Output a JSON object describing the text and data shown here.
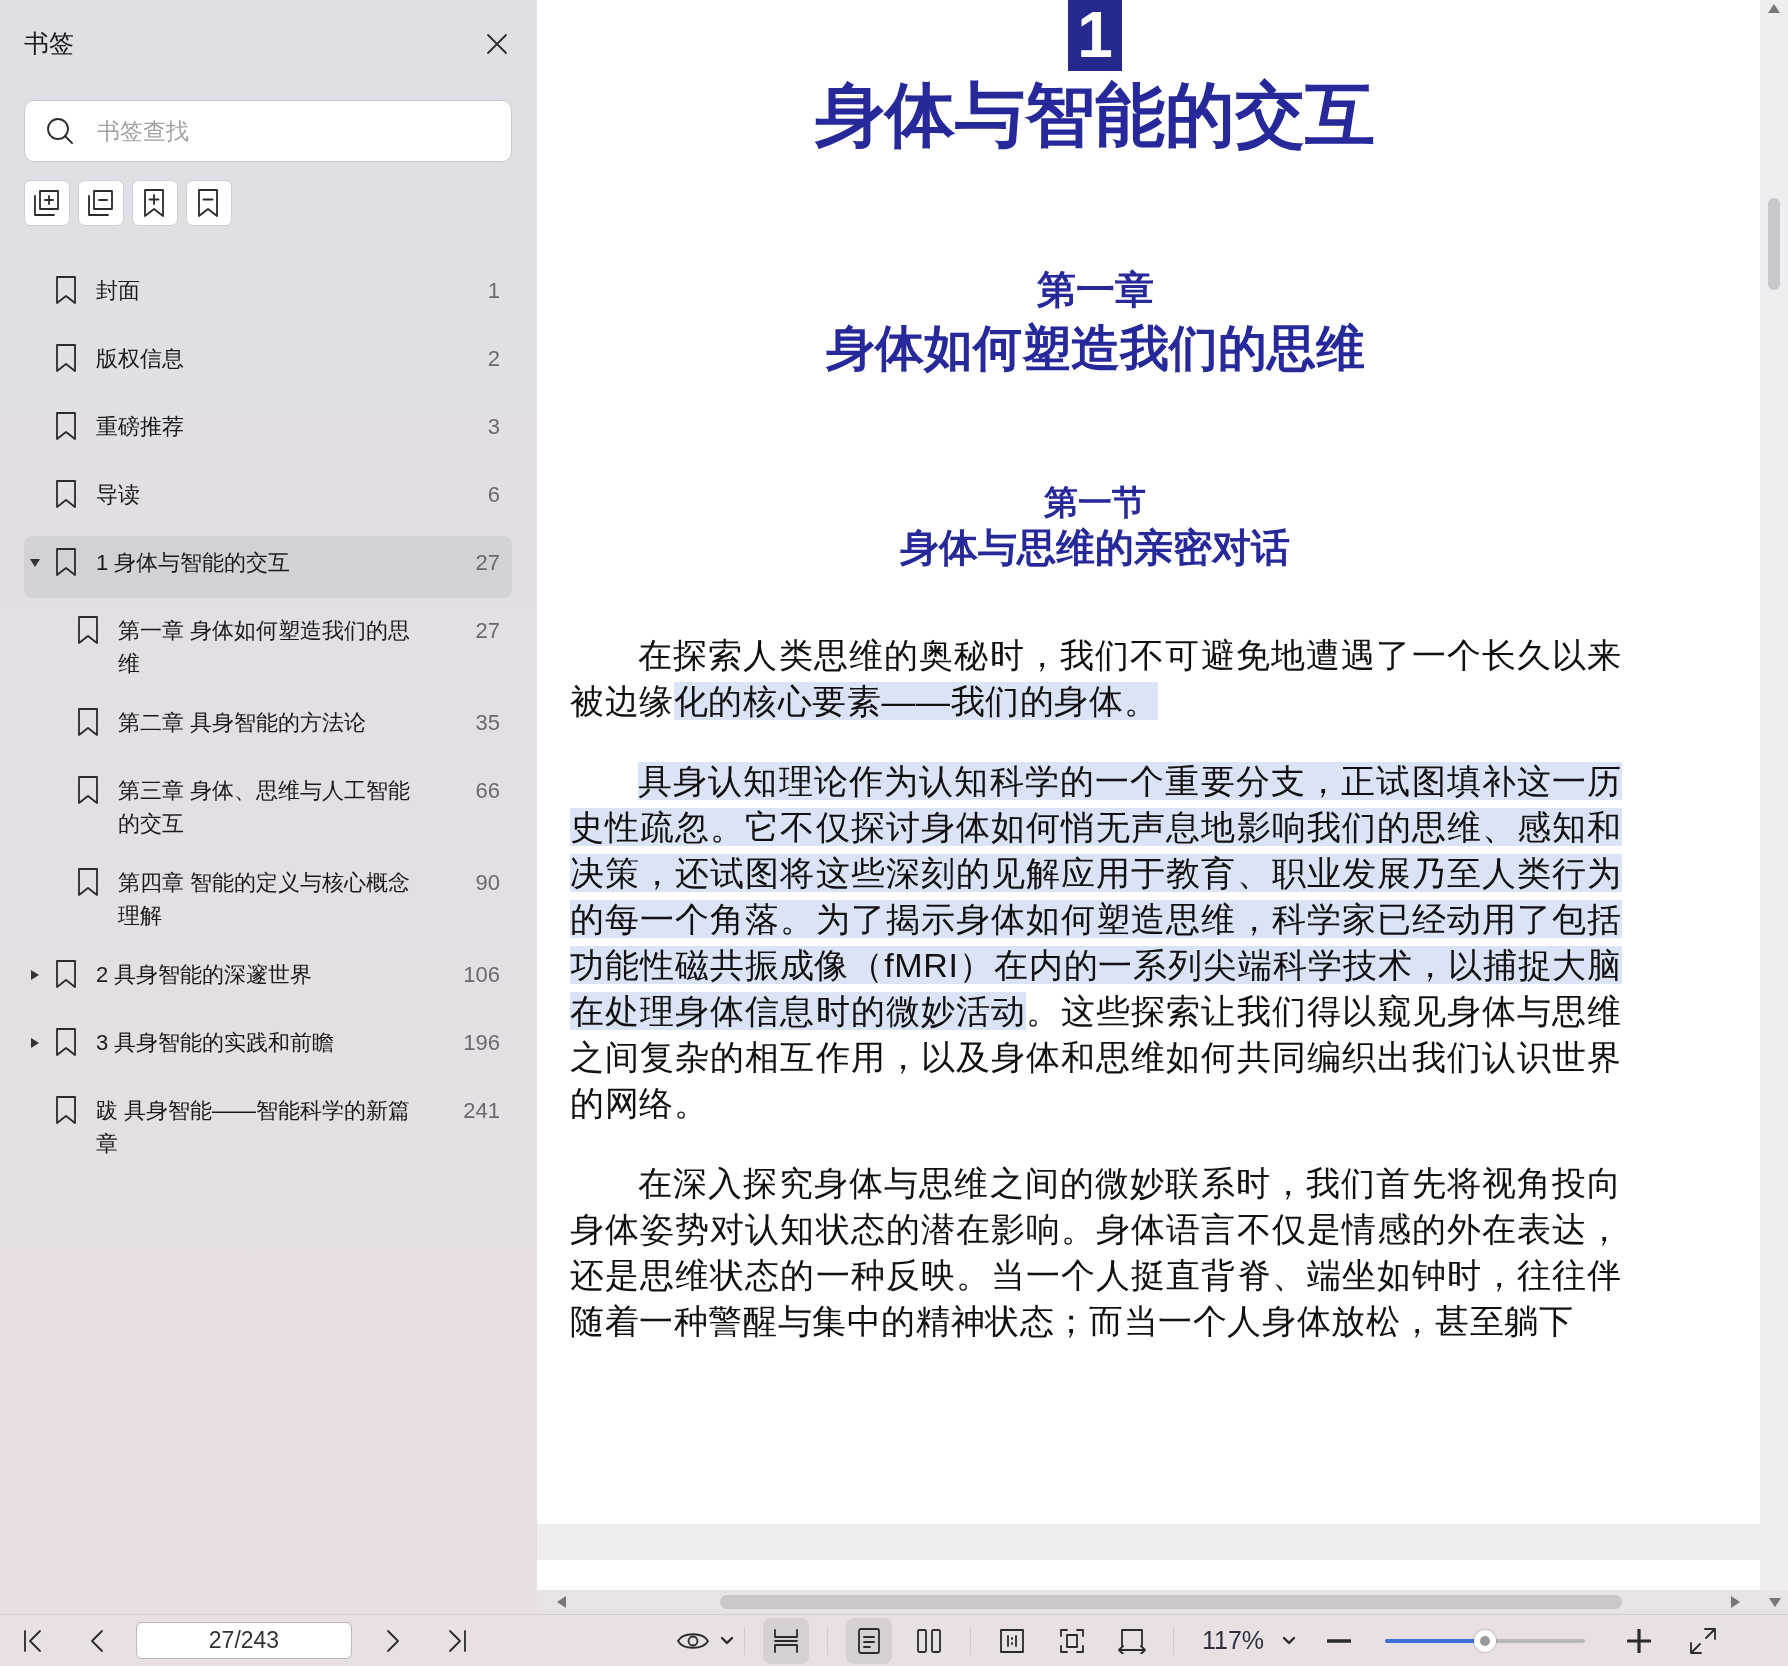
{
  "sidebar": {
    "title": "书签",
    "search": {
      "placeholder": "书签查找"
    },
    "tools": [
      {
        "kind": "expand-all"
      },
      {
        "kind": "collapse-all"
      },
      {
        "kind": "add"
      },
      {
        "kind": "remove"
      }
    ],
    "bookmarks": [
      {
        "label": "封面",
        "page": "1",
        "expandable": false,
        "expanded": false,
        "selected": false
      },
      {
        "label": "版权信息",
        "page": "2",
        "expandable": false,
        "expanded": false,
        "selected": false
      },
      {
        "label": "重磅推荐",
        "page": "3",
        "expandable": false,
        "expanded": false,
        "selected": false
      },
      {
        "label": "导读",
        "page": "6",
        "expandable": false,
        "expanded": false,
        "selected": false
      },
      {
        "label": "1 身体与智能的交互",
        "page": "27",
        "expandable": true,
        "expanded": true,
        "selected": true,
        "children": [
          {
            "label": "第一章 身体如何塑造我们的思维",
            "page": "27",
            "expandable": false,
            "expanded": false,
            "selected": false
          },
          {
            "label": "第二章 具身智能的方法论",
            "page": "35",
            "expandable": false,
            "expanded": false,
            "selected": false
          },
          {
            "label": "第三章 身体、思维与人工智能的交互",
            "page": "66",
            "expandable": false,
            "expanded": false,
            "selected": false
          },
          {
            "label": "第四章 智能的定义与核心概念理解",
            "page": "90",
            "expandable": false,
            "expanded": false,
            "selected": false
          }
        ]
      },
      {
        "label": "2 具身智能的深邃世界",
        "page": "106",
        "expandable": true,
        "expanded": false,
        "selected": false
      },
      {
        "label": "3 具身智能的实践和前瞻",
        "page": "196",
        "expandable": true,
        "expanded": false,
        "selected": false
      },
      {
        "label": "跋 具身智能——智能科学的新篇章",
        "page": "241",
        "expandable": false,
        "expanded": false,
        "selected": false
      }
    ]
  },
  "document": {
    "chapter_number": "1",
    "title": "身体与智能的交互",
    "chapter": "第一章",
    "chapter_title": "身体如何塑造我们的思维",
    "section": "第一节",
    "section_title": "身体与思维的亲密对话",
    "paragraphs": [
      {
        "segments": [
          {
            "text": "在探索人类思维的奥秘时，我们不可避免地遭遇了一个长久以来被边缘",
            "highlighted": false
          },
          {
            "text": "化的核心要素——我们的身体。",
            "highlighted": true
          }
        ]
      },
      {
        "segments": [
          {
            "text": "具身认知理论作为认知科学的一个重要分支，正试图填补这一历史性疏忽。它不仅探讨身体如何悄无声息地影响我们的思维、感知和决策，还试图将这些深刻的见解应用于教育、职业发展乃至人类行为的每一个角落。为了揭示身体如何塑造思维，科学家已经动用了包括功能性磁共振成像（fMRI）在内的一系列尖端科学技术，以捕捉大脑在处理身体信息时的微妙活动",
            "highlighted": true
          },
          {
            "text": "。这些探索让我们得以窥见身体与思维之间复杂的相互作用，以及身体和思维如何共同编织出我们认识世界的网络。",
            "highlighted": false
          }
        ]
      },
      {
        "segments": [
          {
            "text": "在深入探究身体与思维之间的微妙联系时，我们首先将视角投向身体姿势对认知状态的潜在影响。身体语言不仅是情感的外在表达，还是思维状态的一种反映。当一个人挺直背脊、端坐如钟时，往往伴随着一种警醒与集中的精神状态；而当一个人身体放松，甚至躺下",
            "highlighted": false
          }
        ]
      }
    ]
  },
  "toolbar": {
    "page_field": "27/243",
    "view_buttons": [
      {
        "kind": "continuous",
        "selected": true
      },
      {
        "kind": "single",
        "selected": true
      },
      {
        "kind": "two-page",
        "selected": false
      },
      {
        "kind": "actual-size",
        "selected": false
      },
      {
        "kind": "fit-page",
        "selected": false
      },
      {
        "kind": "fit-width",
        "selected": false
      }
    ],
    "zoom": "117%",
    "zoom_slider": {
      "level": 0.5
    }
  }
}
